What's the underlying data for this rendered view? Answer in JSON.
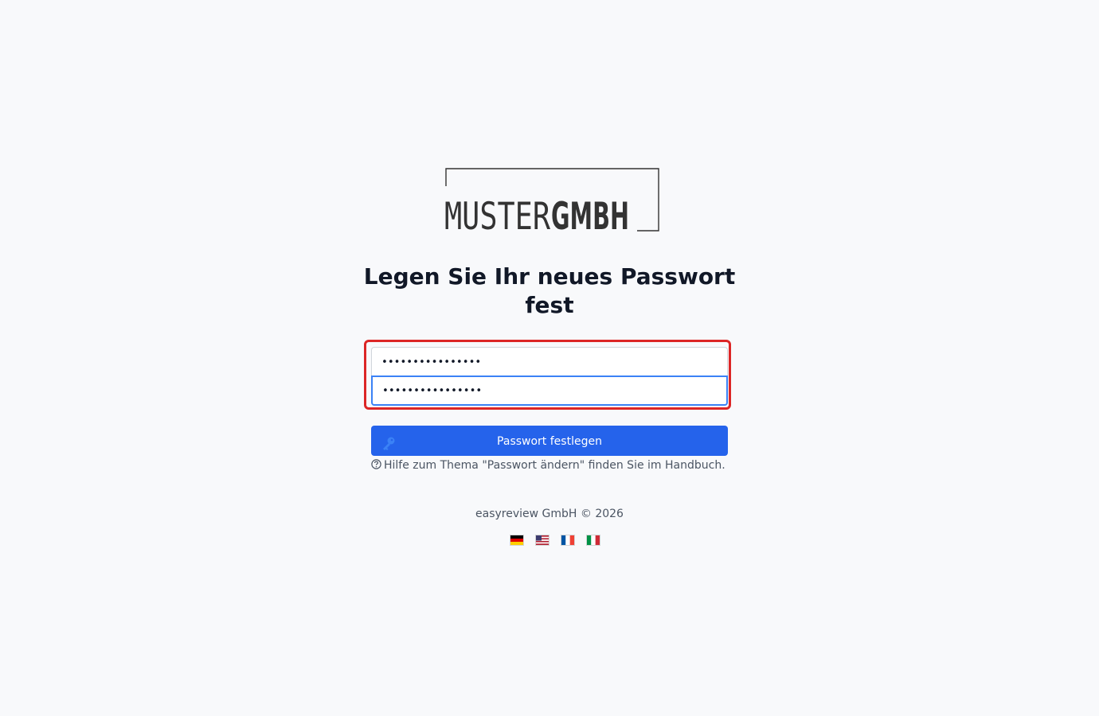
{
  "brand": {
    "logo_part1": "MUSTER",
    "logo_part2": "GMBH"
  },
  "form": {
    "heading": "Legen Sie Ihr neues Passwort fest",
    "password_value": "••••••••••••••••",
    "password_confirm_value": "••••••••••••••••",
    "submit_label": "Passwort festlegen",
    "help_text": "Hilfe zum Thema \"Passwort ändern\" finden Sie im Handbuch."
  },
  "footer": {
    "copyright": "easyreview GmbH © 2026"
  },
  "languages": [
    {
      "code": "de",
      "icon": "flag-germany-icon"
    },
    {
      "code": "en",
      "icon": "flag-usa-icon"
    },
    {
      "code": "fr",
      "icon": "flag-france-icon"
    },
    {
      "code": "it",
      "icon": "flag-italy-icon"
    }
  ],
  "colors": {
    "primary": "#2563eb",
    "highlight": "#dc2626",
    "focus": "#3b82f6",
    "background": "#f8f9fb"
  }
}
